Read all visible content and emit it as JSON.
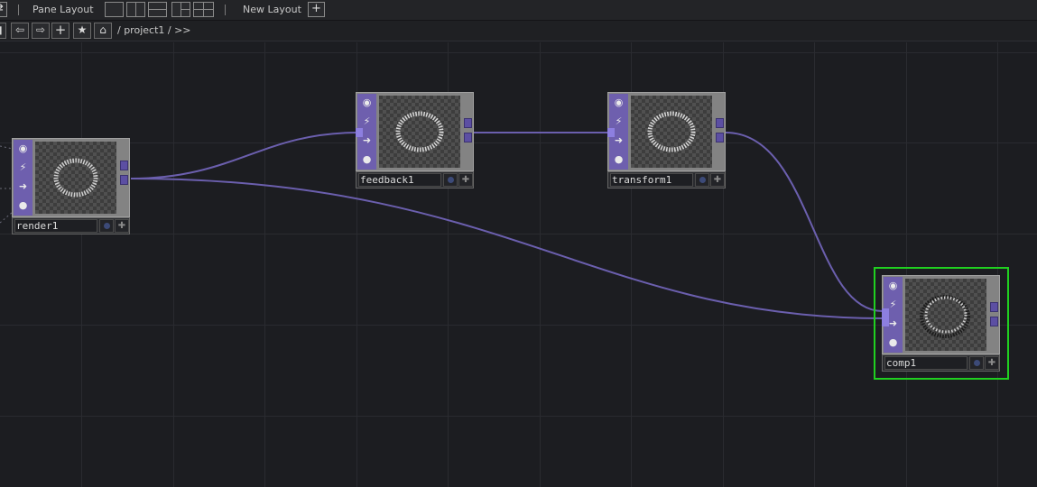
{
  "toolbar": {
    "pane_layout_label": "Pane Layout",
    "new_layout_label": "New Layout",
    "new_layout_plus": "+"
  },
  "pathbar": {
    "plus": "+",
    "star": "★",
    "path": "/ project1 / >>"
  },
  "nodes": [
    {
      "name": "render1"
    },
    {
      "name": "feedback1"
    },
    {
      "name": "transform1"
    },
    {
      "name": "comp1",
      "selected": true
    }
  ],
  "colors": {
    "background": "#1c1d21",
    "node_strip": "#6e5fae",
    "wire": "#6b5fae",
    "selection": "#20d020"
  }
}
